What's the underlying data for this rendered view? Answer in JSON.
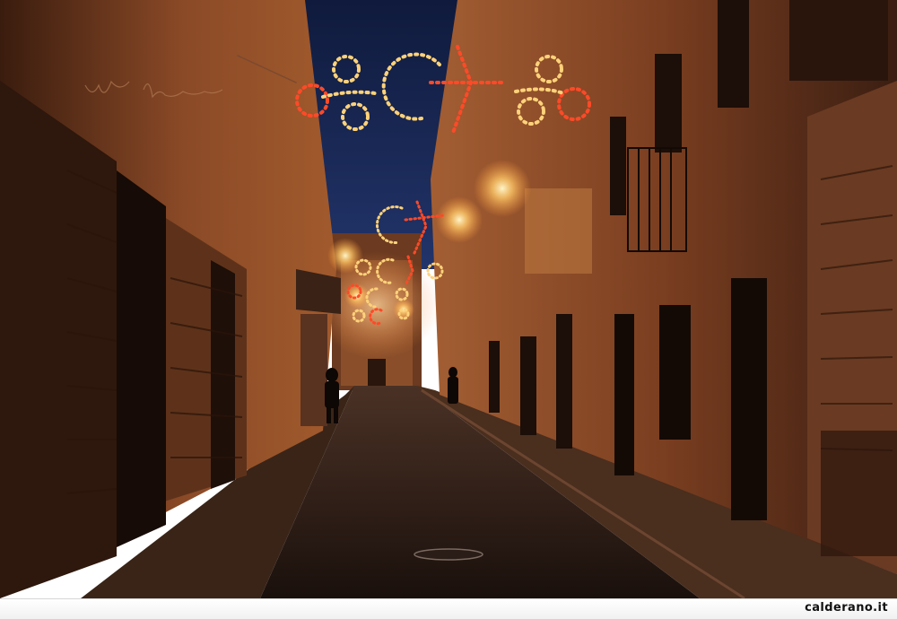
{
  "photo": {
    "subject": "night-street-with-festive-lights",
    "colors": {
      "sky": "#17244d",
      "wall_warm": "#8a4a26",
      "wall_shadow": "#2a150c",
      "road": "#241712",
      "light_gold": "#ffd27a",
      "light_red": "#ff3a1e"
    }
  },
  "caption": {
    "site_name": "calderano.it"
  }
}
